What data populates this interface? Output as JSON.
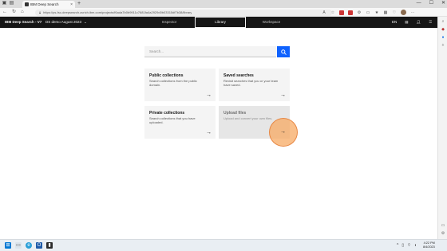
{
  "browser": {
    "tab_title": "IBM Deep Search",
    "tab_close": "×",
    "new_tab": "+",
    "url": "https://ps-fsc-deepsearch.zurich.ibm.com/projects/f6ada7b0b9911c7681fa4a2929d0b03315df7b38/library",
    "window_controls": [
      "—",
      "☐",
      "✕"
    ]
  },
  "app": {
    "title": "IBM Deep Search - V7",
    "project": "DS demo August 2023",
    "tabs": [
      {
        "label": "Inspector",
        "active": false
      },
      {
        "label": "Library",
        "active": true
      },
      {
        "label": "Workspace",
        "active": false
      }
    ],
    "language": "EN"
  },
  "search": {
    "placeholder": "Search..."
  },
  "cards": [
    {
      "title": "Public collections",
      "description": "Search collections from the public domain.",
      "arrow": "→",
      "disabled": false
    },
    {
      "title": "Saved searches",
      "description": "Revisit searches that you or your team have saved.",
      "arrow": "→",
      "disabled": false
    },
    {
      "title": "Private collections",
      "description": "Search collections that you have uploaded.",
      "arrow": "→",
      "disabled": false
    },
    {
      "title": "Upload files",
      "description": "Upload and convert your own files.",
      "arrow": "→",
      "disabled": true
    }
  ],
  "taskbar": {
    "time": "4:22 PM",
    "date": "8/4/2023"
  }
}
